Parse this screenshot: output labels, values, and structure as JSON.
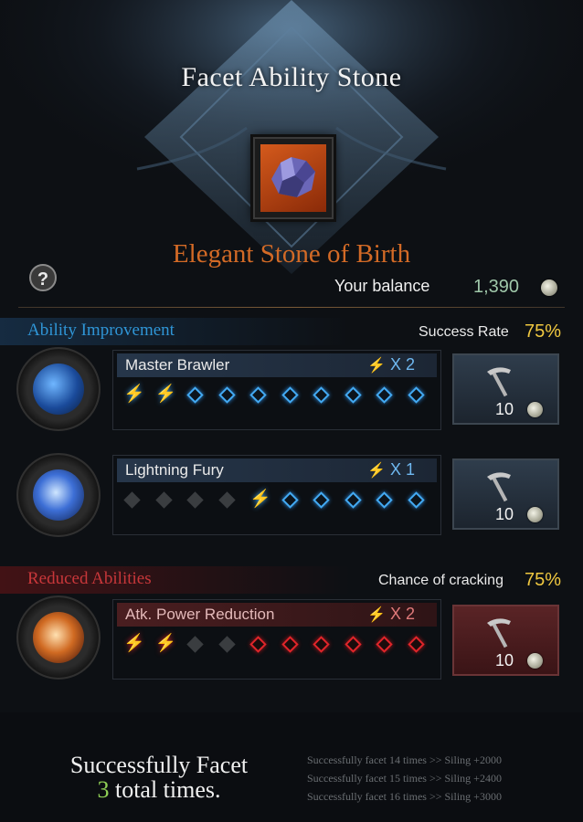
{
  "header": {
    "title": "Facet Ability Stone",
    "stone_name": "Elegant Stone of Birth",
    "balance_label": "Your balance",
    "balance_value": "1,390",
    "help_icon": "question-mark-icon"
  },
  "ability_improvement": {
    "label": "Ability Improvement",
    "rate_label": "Success Rate",
    "rate_value": "75%",
    "rows": [
      {
        "name": "Master Brawler",
        "multiplier": "X 2",
        "slots": [
          "hit",
          "hit",
          "empty",
          "empty",
          "empty",
          "empty",
          "empty",
          "empty",
          "empty",
          "empty"
        ],
        "cost": "10"
      },
      {
        "name": "Lightning Fury",
        "multiplier": "X 1",
        "slots": [
          "fail",
          "fail",
          "fail",
          "fail",
          "hit",
          "empty",
          "empty",
          "empty",
          "empty",
          "empty"
        ],
        "cost": "10"
      }
    ]
  },
  "reduced_abilities": {
    "label": "Reduced Abilities",
    "rate_label": "Chance of cracking",
    "rate_value": "75%",
    "rows": [
      {
        "name": "Atk. Power Reduction",
        "multiplier": "X 2",
        "slots": [
          "hit",
          "hit",
          "fail",
          "fail",
          "empty",
          "empty",
          "empty",
          "empty",
          "empty",
          "empty"
        ],
        "cost": "10"
      }
    ]
  },
  "footer": {
    "line1": "Successfully Facet",
    "count": "3",
    "line2_suffix": " total times.",
    "rewards": [
      "Successfully facet 14 times >> Siling +2000",
      "Successfully facet 15 times >> Siling +2400",
      "Successfully facet 16 times >> Siling +3000"
    ]
  },
  "colors": {
    "ability_label": "#2f95d6",
    "reduced_label": "#c8373a",
    "stone_name": "#d36a26",
    "rate": "#f0c840",
    "blue_slot": "#43aaf3",
    "red_slot": "#e0252a",
    "footer_count": "#8fce55"
  }
}
